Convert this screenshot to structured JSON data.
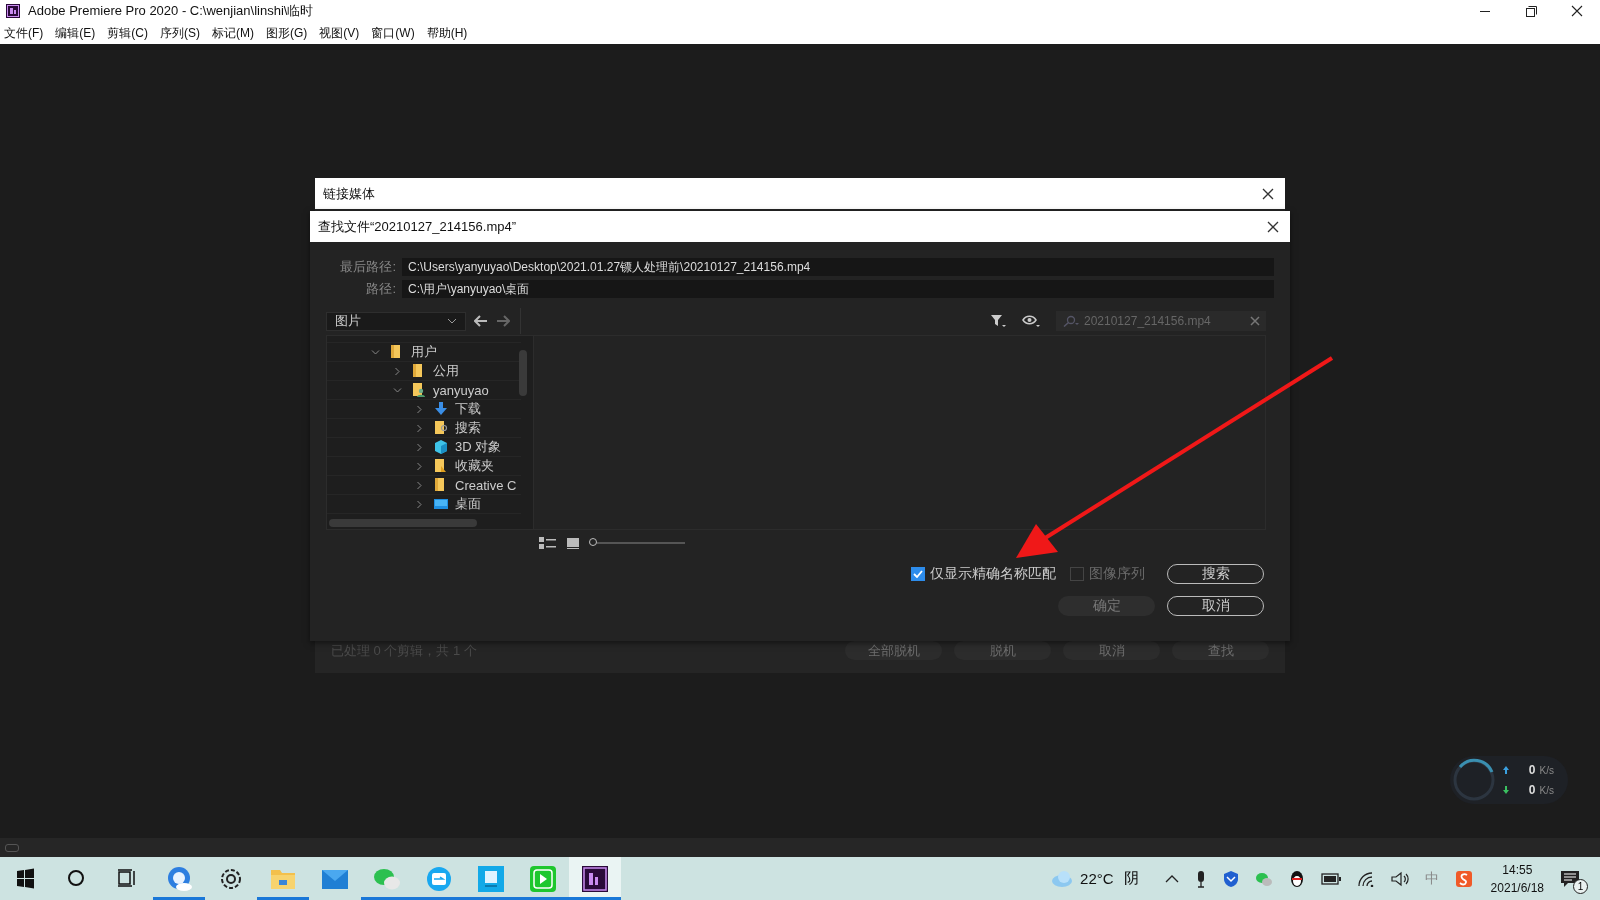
{
  "window": {
    "title": "Adobe Premiere Pro 2020 - C:\\wenjian\\linshi\\临时",
    "menu": [
      "文件(F)",
      "编辑(E)",
      "剪辑(C)",
      "序列(S)",
      "标记(M)",
      "图形(G)",
      "视图(V)",
      "窗口(W)",
      "帮助(H)"
    ]
  },
  "link_media_dialog": {
    "title": "链接媒体",
    "status": "已处理 0 个剪辑，共 1 个",
    "buttons": [
      {
        "label": "全部脱机",
        "disabled": true
      },
      {
        "label": "脱机",
        "disabled": true
      },
      {
        "label": "取消",
        "disabled": true
      },
      {
        "label": "查找",
        "disabled": true
      }
    ]
  },
  "find_file_dialog": {
    "title": "查找文件“20210127_214156.mp4”",
    "last_path": {
      "label": "最后路径:",
      "value": "C:\\Users\\yanyuyao\\Desktop\\2021.01.27镖人处理前\\20210127_214156.mp4"
    },
    "path": {
      "label": "路径:",
      "value": "C:\\用户\\yanyuyao\\桌面"
    },
    "location": "图片",
    "search": {
      "placeholder": "20210127_214156.mp4"
    },
    "tree": [
      {
        "label": "用户",
        "kind": "folder",
        "expanded": true,
        "children": [
          {
            "label": "公用",
            "kind": "folder",
            "expanded": false
          },
          {
            "label": "yanyuyao",
            "kind": "user",
            "expanded": true,
            "children": [
              {
                "label": "下载",
                "kind": "download",
                "expanded": false
              },
              {
                "label": "搜索",
                "kind": "search",
                "expanded": false
              },
              {
                "label": "3D 对象",
                "kind": "cube",
                "expanded": false
              },
              {
                "label": "收藏夹",
                "kind": "favorites",
                "expanded": false
              },
              {
                "label": "Creative C",
                "kind": "folder",
                "expanded": false
              },
              {
                "label": "桌面",
                "kind": "desktop",
                "expanded": false
              }
            ]
          }
        ]
      }
    ],
    "thumb_size": {
      "level": 0
    },
    "options": [
      {
        "label": "仅显示精确名称匹配",
        "checked": true,
        "disabled": false
      },
      {
        "label": "图像序列",
        "checked": false,
        "disabled": true
      }
    ],
    "buttons": [
      {
        "label": "搜索",
        "disabled": false
      },
      {
        "label": "确定",
        "disabled": true
      },
      {
        "label": "取消",
        "disabled": false
      }
    ]
  },
  "net_speed": {
    "up": {
      "value": "0",
      "unit": "K/s"
    },
    "down": {
      "value": "0",
      "unit": "K/s"
    }
  },
  "taskbar": {
    "apps": [
      {
        "kind": "browser",
        "running": true,
        "active": false
      },
      {
        "kind": "settings",
        "running": false,
        "active": false
      },
      {
        "kind": "explorer",
        "running": true,
        "active": false
      },
      {
        "kind": "mail",
        "running": false,
        "active": false
      },
      {
        "kind": "chat",
        "running": true,
        "active": false
      },
      {
        "kind": "transfer",
        "running": true,
        "active": false
      },
      {
        "kind": "notepad",
        "running": true,
        "active": false
      },
      {
        "kind": "player",
        "running": true,
        "active": false
      },
      {
        "kind": "premiere",
        "running": true,
        "active": true
      }
    ],
    "weather": {
      "temperature": "22°C",
      "condition": "阴"
    },
    "ime": "中",
    "time": "14:55",
    "date": "2021/6/18",
    "notifications": "1"
  }
}
